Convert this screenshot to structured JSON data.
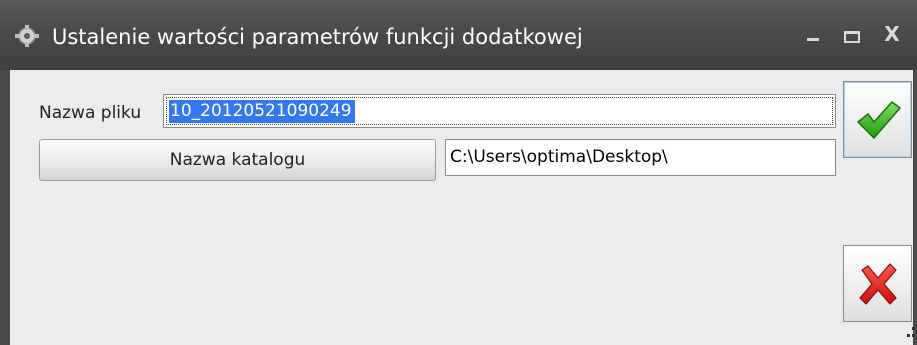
{
  "window": {
    "title": "Ustalenie wartości parametrów funkcji dodatkowej",
    "icon": "app-gear-icon",
    "controls": [
      "minimize",
      "maximize",
      "close"
    ],
    "close_glyph": "X"
  },
  "form": {
    "file_label": "Nazwa pliku",
    "file_value": "10_20120521090249",
    "folder_button_label": "Nazwa katalogu",
    "folder_value": "C:\\Users\\optima\\Desktop\\"
  },
  "actions": {
    "confirm_icon": "green-check-icon",
    "cancel_icon": "red-x-icon"
  },
  "colors": {
    "titlebar": "#4a4a4a",
    "selection": "#3478f0",
    "confirm": "#2fae1f",
    "cancel": "#e01b1b"
  }
}
